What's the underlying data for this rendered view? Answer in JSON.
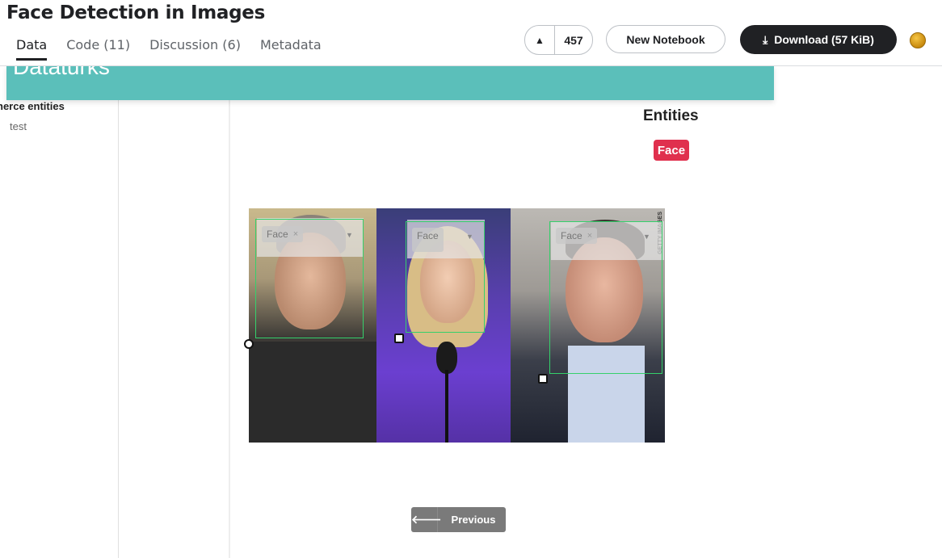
{
  "header": {
    "title": "Face Detection in Images",
    "tabs": [
      {
        "label": "Data",
        "active": true
      },
      {
        "label": "Code (11)"
      },
      {
        "label": "Discussion (6)"
      },
      {
        "label": "Metadata"
      }
    ],
    "vote_count": "457",
    "new_notebook_label": "New Notebook",
    "download_label": "Download (57 KiB)"
  },
  "banner": {
    "text": "Dataturks"
  },
  "sidebar": {
    "heading": "nerce entities",
    "items": [
      {
        "label": "test"
      }
    ]
  },
  "entities": {
    "title": "Entities",
    "tags": [
      {
        "label": "Face",
        "color": "#e0304e"
      }
    ]
  },
  "image": {
    "watermark": "GETTY IMAGES",
    "annotations": [
      {
        "label": "Face",
        "remove": "×"
      },
      {
        "label": "Face",
        "remove": "×"
      },
      {
        "label": "Face",
        "remove": "×"
      }
    ]
  },
  "nav": {
    "previous_label": "Previous"
  },
  "colors": {
    "accent": "#5bbfba",
    "entity": "#e0304e",
    "bbox": "#35d06b"
  }
}
